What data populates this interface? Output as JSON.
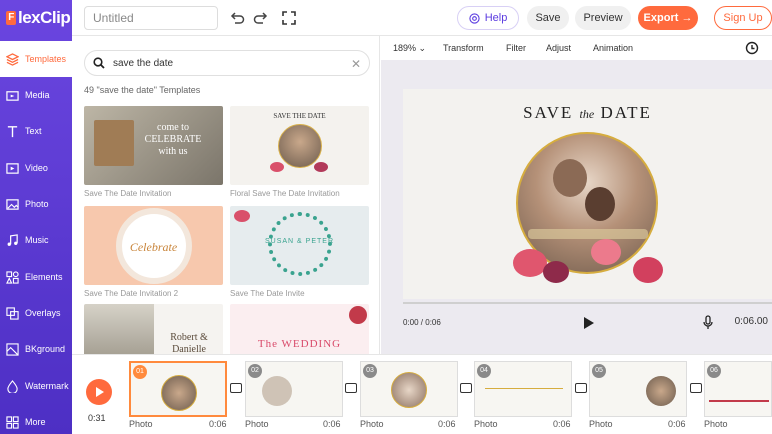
{
  "app": {
    "logo_text": "lexClip",
    "logo_letter": "F"
  },
  "sidebar": {
    "items": [
      {
        "label": "Templates",
        "icon": "layers-icon",
        "active": true
      },
      {
        "label": "Media",
        "icon": "folder-icon"
      },
      {
        "label": "Text",
        "icon": "text-icon"
      },
      {
        "label": "Video",
        "icon": "video-icon"
      },
      {
        "label": "Photo",
        "icon": "photo-icon"
      },
      {
        "label": "Music",
        "icon": "music-icon"
      },
      {
        "label": "Elements",
        "icon": "elements-icon"
      },
      {
        "label": "Overlays",
        "icon": "overlays-icon"
      },
      {
        "label": "BKground",
        "icon": "background-icon"
      },
      {
        "label": "Watermark",
        "icon": "watermark-icon"
      },
      {
        "label": "More",
        "icon": "more-icon"
      }
    ]
  },
  "topbar": {
    "title_placeholder": "Untitled",
    "help": "Help",
    "save": "Save",
    "preview": "Preview",
    "export": "Export →",
    "signup": "Sign Up"
  },
  "templates": {
    "search_value": "save the date",
    "result_count": "49 \"save the date\" Templates",
    "cards": [
      {
        "caption": "Save The Date Invitation",
        "thumb_text": "come to\nCELEBRATE\nwith us",
        "bg": "#9a9382"
      },
      {
        "caption": "Floral Save The Date Invitation",
        "thumb_text": "SAVE THE DATE",
        "bg": "#f4f2ee"
      },
      {
        "caption": "Save The Date Invitation 2",
        "thumb_text": "Celebrate",
        "bg": "#f7c8ad"
      },
      {
        "caption": "Save The Date Invite",
        "thumb_text": "SUSAN & PETER",
        "bg": "#e8eef0"
      },
      {
        "caption": "",
        "thumb_text": "Robert & Danielle",
        "bg": "#f5f3f0"
      },
      {
        "caption": "",
        "thumb_text": "The WEDDING",
        "bg": "#fbeef0"
      }
    ]
  },
  "editor": {
    "zoom": "189%",
    "tools": [
      "Transform",
      "Filter",
      "Adjust",
      "Animation"
    ],
    "canvas_title_left": "SAVE",
    "canvas_title_mid": "the",
    "canvas_title_right": "DATE",
    "time_current": "0:00 / 0:06",
    "time_total": "0:06.00"
  },
  "timeline": {
    "total": "0:31",
    "scenes": [
      {
        "num": "01",
        "label": "Photo",
        "dur": "0:06",
        "active": true
      },
      {
        "num": "02",
        "label": "Photo",
        "dur": "0:06"
      },
      {
        "num": "03",
        "label": "Photo",
        "dur": "0:06"
      },
      {
        "num": "04",
        "label": "Photo",
        "dur": "0:06"
      },
      {
        "num": "05",
        "label": "Photo",
        "dur": "0:06"
      },
      {
        "num": "06",
        "label": "Photo",
        "dur": ""
      }
    ]
  },
  "colors": {
    "brand": "#5b3be0",
    "accent": "#ff6a3d"
  }
}
